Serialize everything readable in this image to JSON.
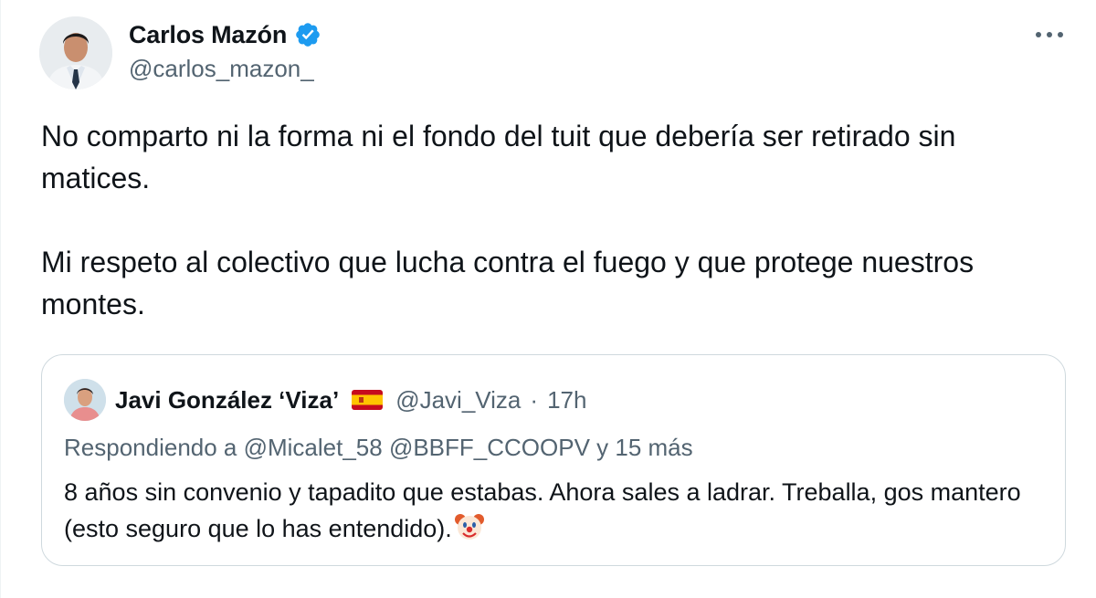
{
  "author": {
    "name": "Carlos Mazón",
    "handle": "@carlos_mazon_",
    "verified": true,
    "accent_color": "#1d9bf0"
  },
  "more_icon": "more-horizontal-icon",
  "tweet": {
    "paragraph_1": "No comparto ni la forma ni el fondo del tuit que debería ser retirado sin matices.",
    "paragraph_2": "Mi respeto al colectivo que lucha contra el fuego y que protege nuestros montes."
  },
  "quoted_tweet": {
    "name": "Javi González ‘Viza’",
    "flag_icon": "spain-flag-icon",
    "handle": "@Javi_Viza",
    "separator": "·",
    "time": "17h",
    "replying_to": "Respondiendo a @Micalet_58 @BBFF_CCOOPV y 15 más",
    "text": "8 años sin convenio y tapadito que estabas. Ahora sales a ladrar. Treballa, gos mantero (esto seguro que lo has entendido).",
    "emoji_icon": "clown-face-icon"
  }
}
